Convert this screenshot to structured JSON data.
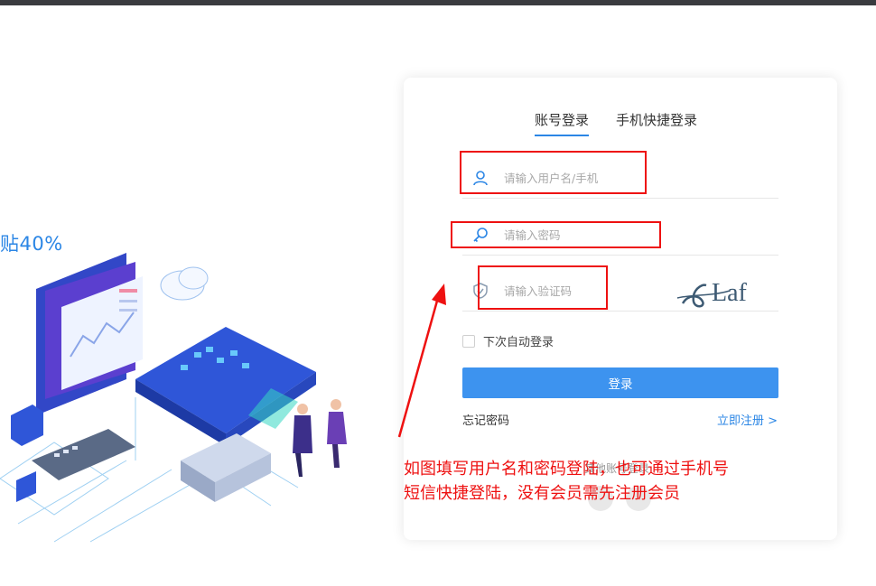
{
  "promo": {
    "text": "贴40%"
  },
  "login": {
    "tabs": [
      {
        "label": "账号登录",
        "active": true
      },
      {
        "label": "手机快捷登录",
        "active": false
      }
    ],
    "username": {
      "placeholder": "请输入用户名/手机",
      "value": "",
      "icon": "user-icon"
    },
    "password": {
      "placeholder": "请输入密码",
      "value": "",
      "icon": "key-icon"
    },
    "captcha": {
      "placeholder": "请输入验证码",
      "value": "",
      "icon": "shield-icon",
      "image_text": "Laf"
    },
    "remember_label": "下次自动登录",
    "submit_label": "登录",
    "forgot_label": "忘记密码",
    "register_label": "立即注册 >",
    "other_login_label": "其他账号登录"
  },
  "annotation": {
    "color": "#ee1111",
    "lines": [
      "如图填写用户名和密码登陆，也可通过手机号",
      "短信快捷登陆，没有会员需先注册会员"
    ]
  },
  "colors": {
    "accent": "#2b86e5",
    "button": "#3d93ef",
    "topbar": "#3a3b3f"
  }
}
